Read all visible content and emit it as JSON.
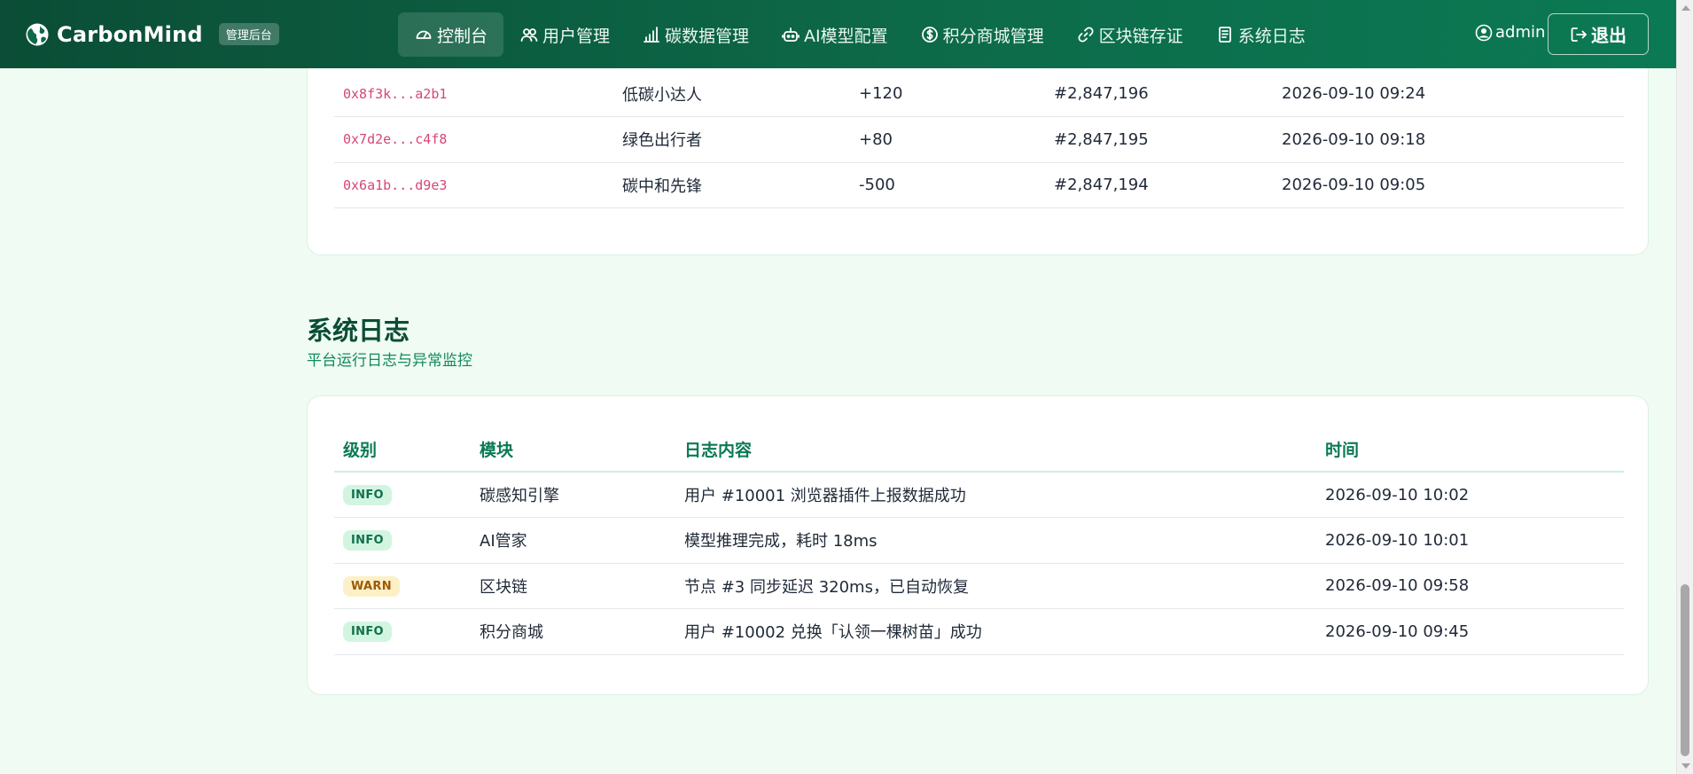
{
  "brand": {
    "name": "CarbonMind",
    "badge": "管理后台"
  },
  "nav": [
    {
      "label": "控制台",
      "icon": "dashboard-icon",
      "active": true
    },
    {
      "label": "用户管理",
      "icon": "users-icon"
    },
    {
      "label": "碳数据管理",
      "icon": "bar-chart-icon"
    },
    {
      "label": "AI模型配置",
      "icon": "robot-icon"
    },
    {
      "label": "积分商城管理",
      "icon": "coin-icon"
    },
    {
      "label": "区块链存证",
      "icon": "link-icon"
    },
    {
      "label": "系统日志",
      "icon": "document-icon"
    }
  ],
  "user": {
    "name": "admin"
  },
  "logout_label": "退出",
  "chain": {
    "rows": [
      {
        "hash": "0x8f3k...a2b1",
        "name": "低碳小达人",
        "points": "+120",
        "block": "#2,847,196",
        "time": "2026-09-10 09:24"
      },
      {
        "hash": "0x7d2e...c4f8",
        "name": "绿色出行者",
        "points": "+80",
        "block": "#2,847,195",
        "time": "2026-09-10 09:18"
      },
      {
        "hash": "0x6a1b...d9e3",
        "name": "碳中和先锋",
        "points": "-500",
        "block": "#2,847,194",
        "time": "2026-09-10 09:05"
      }
    ]
  },
  "logs": {
    "title": "系统日志",
    "subtitle": "平台运行日志与异常监控",
    "headers": {
      "level": "级别",
      "module": "模块",
      "content": "日志内容",
      "time": "时间"
    },
    "rows": [
      {
        "level": "INFO",
        "module": "碳感知引擎",
        "content": "用户 #10001 浏览器插件上报数据成功",
        "time": "2026-09-10 10:02"
      },
      {
        "level": "INFO",
        "module": "AI管家",
        "content": "模型推理完成，耗时 18ms",
        "time": "2026-09-10 10:01"
      },
      {
        "level": "WARN",
        "module": "区块链",
        "content": "节点 #3 同步延迟 320ms，已自动恢复",
        "time": "2026-09-10 09:58"
      },
      {
        "level": "INFO",
        "module": "积分商城",
        "content": "用户 #10002 兑换「认领一棵树苗」成功",
        "time": "2026-09-10 09:45"
      }
    ]
  },
  "colors": {
    "nav_bg": "#0d6a49",
    "accent": "#0b7a54",
    "positive": "#1f9d67",
    "negative": "#dc3b3b",
    "hash": "#d6457a"
  }
}
